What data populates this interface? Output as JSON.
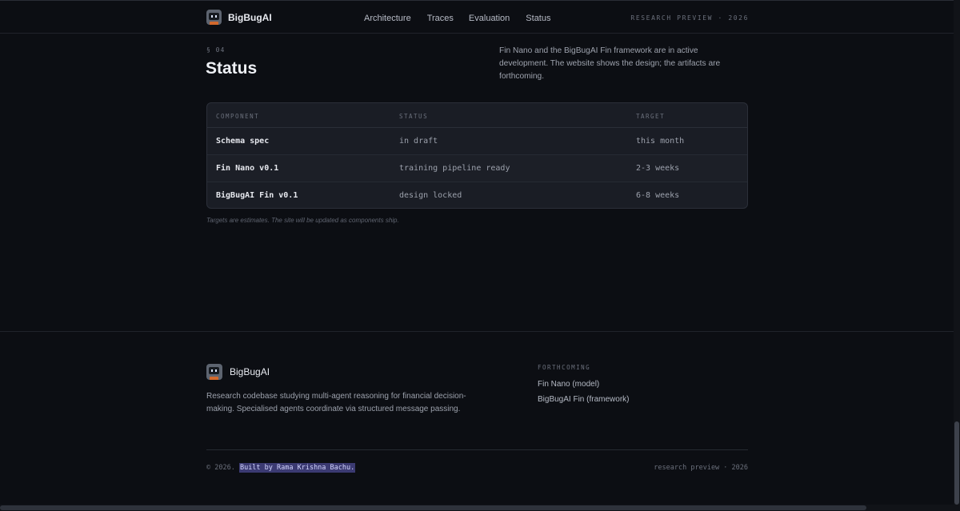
{
  "header": {
    "brand": "BigBugAI",
    "nav": [
      "Architecture",
      "Traces",
      "Evaluation",
      "Status"
    ],
    "tag": "RESEARCH PREVIEW · 2026"
  },
  "section": {
    "number": "§ 04",
    "title": "Status",
    "description": "Fin Nano and the BigBugAI Fin framework are in active development. The website shows the design; the artifacts are forthcoming."
  },
  "table": {
    "headers": [
      "COMPONENT",
      "STATUS",
      "TARGET"
    ],
    "rows": [
      [
        "Schema spec",
        "in draft",
        "this month"
      ],
      [
        "Fin Nano v0.1",
        "training pipeline ready",
        "2-3 weeks"
      ],
      [
        "BigBugAI Fin v0.1",
        "design locked",
        "6-8 weeks"
      ]
    ],
    "note": "Targets are estimates. The site will be updated as components ship."
  },
  "footer": {
    "brand": "BigBugAI",
    "description": "Research codebase studying multi-agent reasoning for financial decision-making. Specialised agents coordinate via structured message passing.",
    "forthcoming_heading": "FORTHCOMING",
    "links": [
      "Fin Nano (model)",
      "BigBugAI Fin (framework)"
    ],
    "copyright_prefix": "© 2026.",
    "built_by": "Built by Rama Krishna Bachu.",
    "right_tag": "research preview · 2026"
  },
  "colors": {
    "background": "#0c0e13",
    "card": "#1a1d25",
    "highlight": "#3b3a72"
  },
  "icons": [
    "bigbugai-logo-icon"
  ]
}
